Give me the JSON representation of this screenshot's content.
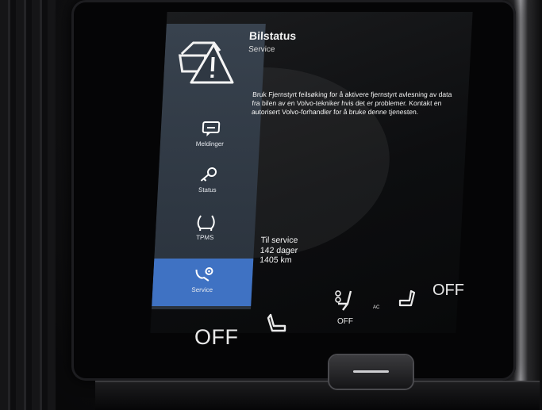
{
  "screen": {
    "header": {
      "title": "Bilstatus",
      "subtitle": "Service",
      "hero_icon": "car-warning-icon"
    },
    "sidebar": {
      "items": [
        {
          "label": "Meldinger",
          "icon": "message-icon",
          "active": false
        },
        {
          "label": "Status",
          "icon": "key-icon",
          "active": false
        },
        {
          "label": "TPMS",
          "icon": "tire-pressure-icon",
          "active": false
        },
        {
          "label": "Service",
          "icon": "wrench-icon",
          "active": true
        }
      ]
    },
    "message": "Bruk Fjernstyrt feilsøking for å aktivere fjernstyrt avlesning av data fra bilen av en Volvo-tekniker hvis det er problemer. Kontakt en autorisert Volvo-forhandler for å bruke denne tjenesten.",
    "service": {
      "line1": "Til service",
      "line2": "142 dager",
      "line3": "1405 km"
    }
  },
  "climate": {
    "left_temp": "OFF",
    "right_temp": "OFF",
    "fan": "OFF",
    "ac_label": "AC",
    "seat_left_icon": "seat-heat-left-icon",
    "seat_right_icon": "seat-heat-right-icon",
    "fan_icon": "fan-seat-icon"
  },
  "colors": {
    "sidebar_bg": "#333d48",
    "active_item": "#3f72c3",
    "screen_bg": "#101113",
    "text": "#f4f4f4"
  }
}
